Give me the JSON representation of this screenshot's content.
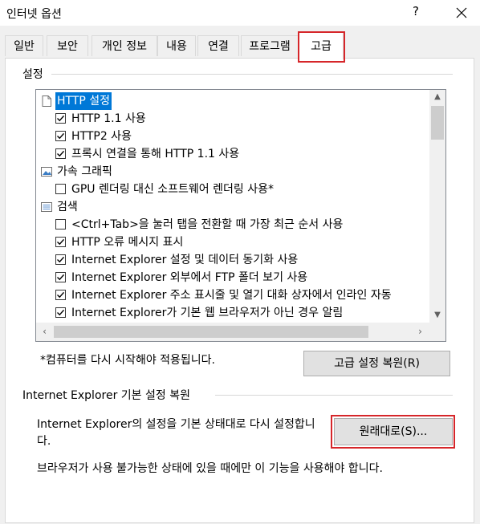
{
  "window": {
    "title": "인터넷 옵션",
    "help_label": "?"
  },
  "tabs": [
    {
      "label": "일반"
    },
    {
      "label": "보안"
    },
    {
      "label": "개인 정보"
    },
    {
      "label": "내용"
    },
    {
      "label": "연결"
    },
    {
      "label": "프로그램"
    },
    {
      "label": "고급"
    }
  ],
  "active_tab": "고급",
  "settings": {
    "group_label": "설정",
    "items": [
      {
        "type": "category",
        "icon": "page-icon",
        "label": "HTTP 설정",
        "selected": true
      },
      {
        "type": "checkbox",
        "checked": true,
        "label": "HTTP 1.1 사용"
      },
      {
        "type": "checkbox",
        "checked": true,
        "label": "HTTP2 사용"
      },
      {
        "type": "checkbox",
        "checked": true,
        "label": "프록시 연결을 통해 HTTP 1.1 사용"
      },
      {
        "type": "category",
        "icon": "image-icon",
        "label": "가속 그래픽"
      },
      {
        "type": "checkbox",
        "checked": false,
        "label": "GPU 렌더링 대신 소프트웨어 렌더링 사용*"
      },
      {
        "type": "category",
        "icon": "list-icon",
        "label": "검색"
      },
      {
        "type": "checkbox",
        "checked": false,
        "label": "<Ctrl+Tab>을 눌러 탭을 전환할 때 가장 최근 순서 사용"
      },
      {
        "type": "checkbox",
        "checked": true,
        "label": "HTTP 오류 메시지 표시"
      },
      {
        "type": "checkbox",
        "checked": true,
        "label": "Internet Explorer 설정 및 데이터 동기화 사용"
      },
      {
        "type": "checkbox",
        "checked": true,
        "label": "Internet Explorer 외부에서 FTP 폴더 보기 사용"
      },
      {
        "type": "checkbox",
        "checked": true,
        "label": "Internet Explorer 주소 표시줄 및 열기 대화 상자에서 인라인 자동"
      },
      {
        "type": "checkbox",
        "checked": true,
        "label": "Internet Explorer가 기본 웹 브라우저가 아닌 경우 알림"
      }
    ],
    "restart_note": "*컴퓨터를 다시 시작해야 적용됩니다.",
    "reset_advanced_label": "고급 설정 복원(R)"
  },
  "ie_reset": {
    "group_label": "Internet Explorer 기본 설정 복원",
    "description": "Internet Explorer의 설정을 기본 상태대로 다시 설정합니다.",
    "restore_label": "원래대로(S)...",
    "warning": "브라우저가 사용 불가능한 상태에 있을 때에만 이 기능을 사용해야 합니다."
  },
  "colors": {
    "highlight": "#d6262a",
    "selection": "#0078d7"
  }
}
